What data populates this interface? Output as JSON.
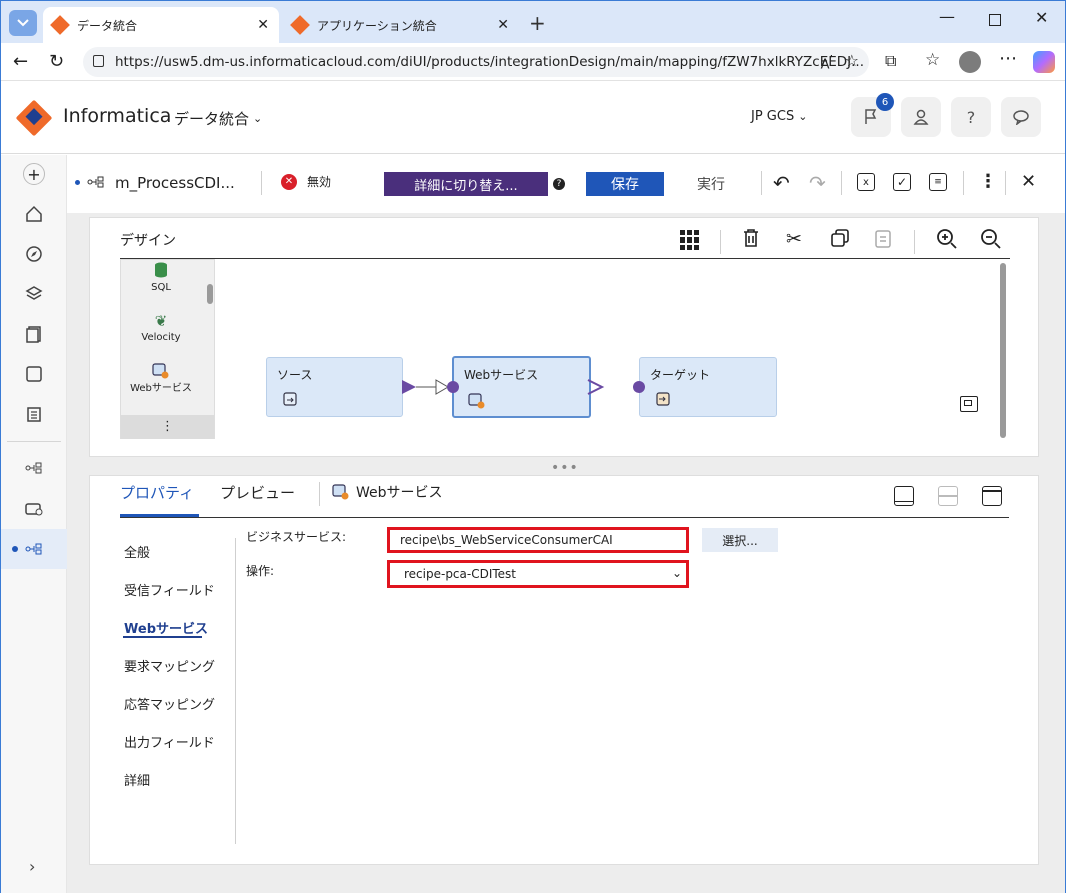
{
  "browser": {
    "tabs": [
      {
        "title": "データ統合",
        "active": true
      },
      {
        "title": "アプリケーション統合",
        "active": false
      }
    ],
    "url": "https://usw5.dm-us.informaticacloud.com/diUI/products/integrationDesign/main/mapping/fZW7hxlkRYZcEEDJ..."
  },
  "app": {
    "brand": "Informatica",
    "product": "データ統合",
    "org": "JP GCS",
    "notifications_count": "6"
  },
  "toolbar": {
    "mapping_name": "m_ProcessCDI...",
    "status": "無効",
    "switch_label": "詳細に切り替え...",
    "save_label": "保存",
    "run_label": "実行"
  },
  "design": {
    "title": "デザイン",
    "palette": [
      {
        "label": "SQL",
        "icon": "database-icon"
      },
      {
        "label": "Velocity",
        "icon": "velocity-icon"
      },
      {
        "label": "Webサービス",
        "icon": "web-service-icon"
      }
    ],
    "palette_more": "⋮",
    "nodes": [
      {
        "label": "ソース",
        "icon": "source-icon"
      },
      {
        "label": "Webサービス",
        "icon": "web-service-icon"
      },
      {
        "label": "ターゲット",
        "icon": "target-icon"
      }
    ]
  },
  "properties": {
    "tabs": [
      {
        "label": "プロパティ",
        "active": true
      },
      {
        "label": "プレビュー",
        "active": false
      }
    ],
    "context": "Webサービス",
    "nav": [
      "全般",
      "受信フィールド",
      "Webサービス",
      "要求マッピング",
      "応答マッピング",
      "出力フィールド",
      "詳細"
    ],
    "active_nav": "Webサービス",
    "business_service_label": "ビジネスサービス:",
    "business_service_value": "recipe\\bs_WebServiceConsumerCAI",
    "select_button": "選択...",
    "operation_label": "操作:",
    "operation_value": "recipe-pca-CDITest"
  },
  "colors": {
    "accent_blue": "#1f56b8",
    "switch_purple": "#4a2f7c",
    "highlight_red": "#e0141e",
    "node_fill": "#dbe8f8",
    "port_purple": "#6a4aa3"
  }
}
